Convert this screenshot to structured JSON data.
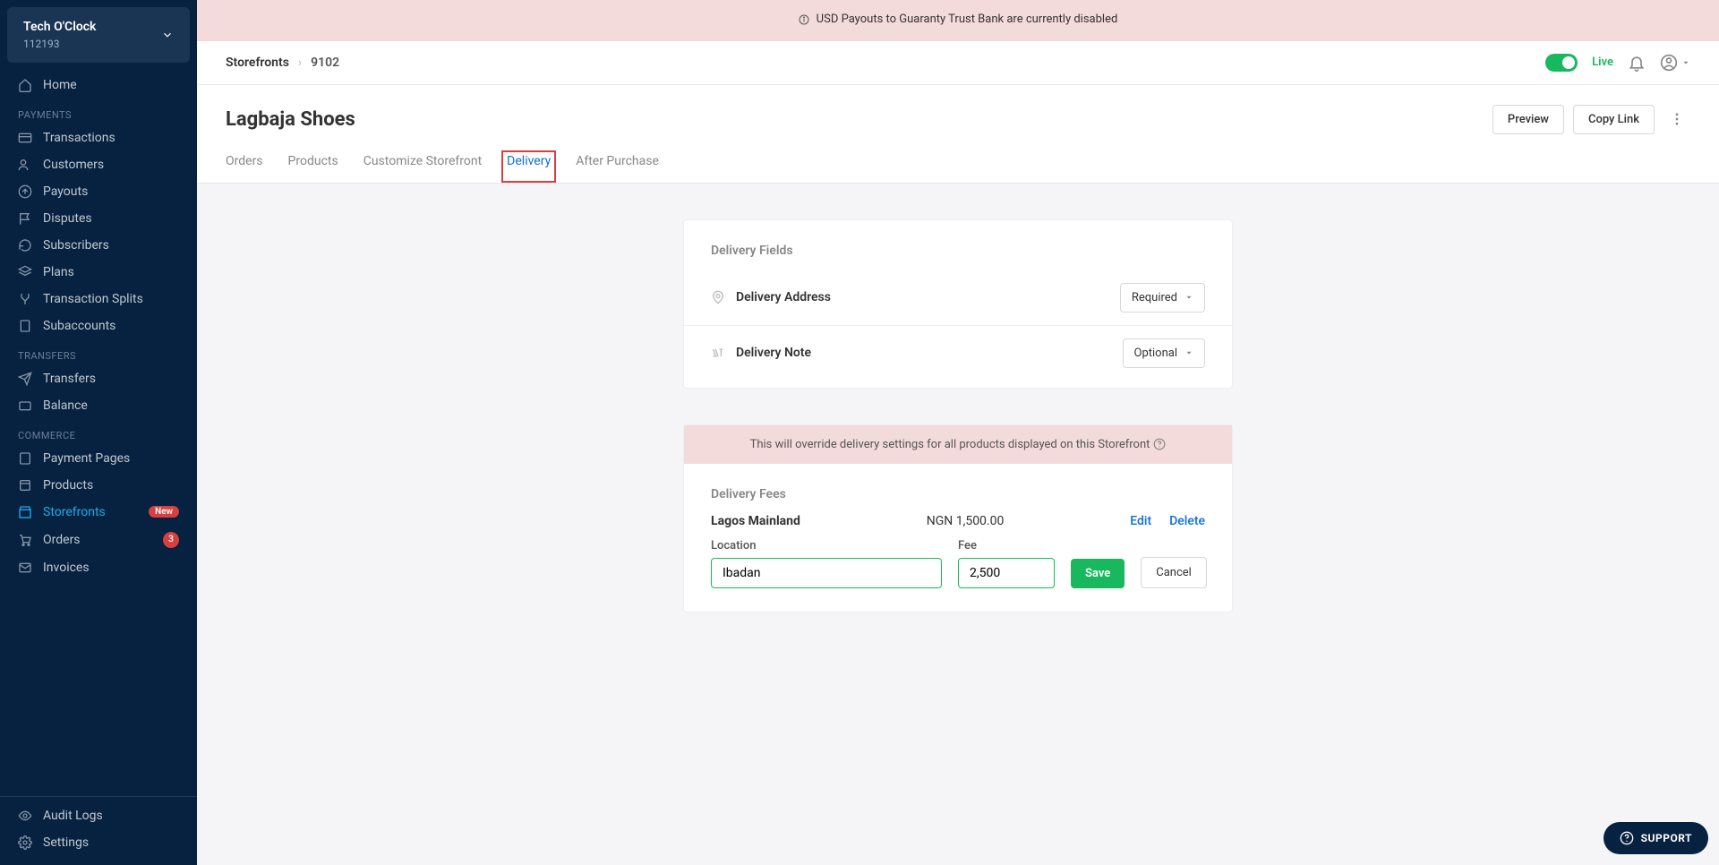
{
  "org": {
    "name": "Tech O'Clock",
    "id": "112193"
  },
  "sidebar": {
    "home": "Home",
    "sections": {
      "payments": "PAYMENTS",
      "transfers": "TRANSFERS",
      "commerce": "COMMERCE"
    },
    "items": {
      "transactions": "Transactions",
      "customers": "Customers",
      "payouts": "Payouts",
      "disputes": "Disputes",
      "subscribers": "Subscribers",
      "plans": "Plans",
      "transaction_splits": "Transaction Splits",
      "subaccounts": "Subaccounts",
      "transfers": "Transfers",
      "balance": "Balance",
      "payment_pages": "Payment Pages",
      "products": "Products",
      "storefronts": "Storefronts",
      "orders": "Orders",
      "invoices": "Invoices",
      "audit_logs": "Audit Logs",
      "settings": "Settings"
    },
    "badges": {
      "storefronts_new": "New",
      "orders_count": "3"
    }
  },
  "banner": {
    "text": "USD Payouts to Guaranty Trust Bank are currently disabled"
  },
  "breadcrumb": {
    "root": "Storefronts",
    "current": "9102"
  },
  "topbar": {
    "live": "Live"
  },
  "page": {
    "title": "Lagbaja Shoes"
  },
  "actions": {
    "preview": "Preview",
    "copy_link": "Copy Link"
  },
  "tabs": {
    "orders": "Orders",
    "products": "Products",
    "customize": "Customize Storefront",
    "delivery": "Delivery",
    "after": "After Purchase"
  },
  "delivery_card": {
    "title": "Delivery Fields",
    "address_label": "Delivery Address",
    "address_setting": "Required",
    "note_label": "Delivery Note",
    "note_setting": "Optional"
  },
  "fees_card": {
    "warning": "This will override delivery settings for all products displayed on this Storefront",
    "title": "Delivery Fees",
    "existing": {
      "location": "Lagos Mainland",
      "amount": "NGN 1,500.00",
      "edit": "Edit",
      "delete": "Delete"
    },
    "form": {
      "location_label": "Location",
      "location_value": "Ibadan",
      "fee_label": "Fee",
      "fee_value": "2,500",
      "save": "Save",
      "cancel": "Cancel"
    }
  },
  "support": "SUPPORT"
}
